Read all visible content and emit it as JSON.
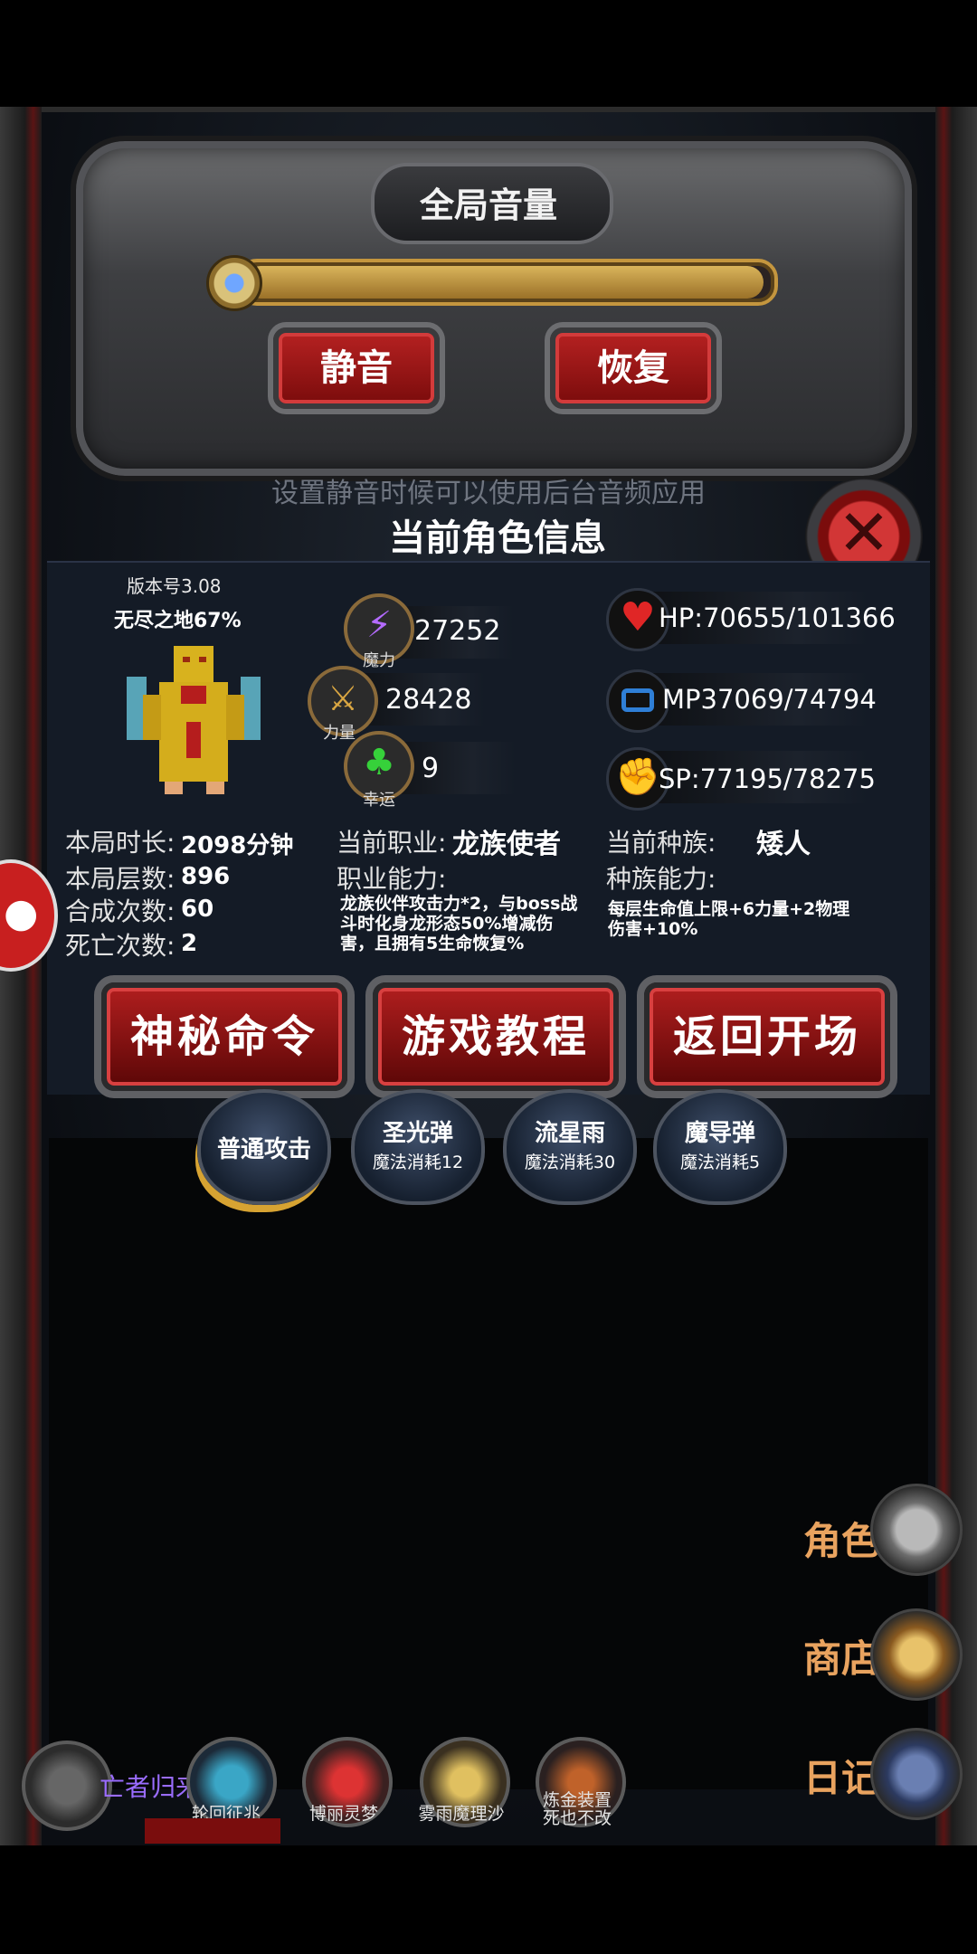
{
  "volume": {
    "title": "全局音量",
    "level_fraction": 1.0,
    "mute_label": "静音",
    "restore_label": "恢复",
    "hint": "设置静音时候可以使用后台音频应用"
  },
  "info": {
    "title": "当前角色信息",
    "version": "版本号3.08",
    "floor_pct": "无尽之地67%",
    "magic": {
      "value": "27252",
      "label": "魔力"
    },
    "strength": {
      "value": "28428",
      "label": "力量"
    },
    "luck": {
      "value": "9",
      "label": "幸运"
    },
    "hp": "HP:70655/101366",
    "mp": "MP37069/74794",
    "sp": "SP:77195/78275",
    "duration_label": "本局时长:",
    "duration_value": "2098分钟",
    "floors_label": "本局层数:",
    "floors_value": "896",
    "synth_label": "合成次数:",
    "synth_value": "60",
    "death_label": "死亡次数:",
    "death_value": "2",
    "job_label": "当前职业:",
    "job_value": "龙族使者",
    "job_ability_label": "职业能力:",
    "job_ability_desc": "龙族伙伴攻击力*2，与boss战斗时化身龙形态50%增减伤害，且拥有5生命恢复%",
    "race_label": "当前种族:",
    "race_value": "矮人",
    "race_ability_label": "种族能力:",
    "race_ability_desc": "每层生命值上限+6力量+2物理伤害+10%"
  },
  "actions": {
    "mystery_cmd": "神秘命令",
    "tutorial": "游戏教程",
    "back_to_start": "返回开场"
  },
  "skills": [
    {
      "name": "普通攻击",
      "cost": ""
    },
    {
      "name": "圣光弹",
      "cost": "魔法消耗12"
    },
    {
      "name": "流星雨",
      "cost": "魔法消耗30"
    },
    {
      "name": "魔导弹",
      "cost": "魔法消耗5"
    }
  ],
  "side_menu": {
    "character": "角色",
    "shop": "商店",
    "diary": "日记"
  },
  "bottom": {
    "undead_return": "亡者归来",
    "items": [
      "轮回征兆",
      "博丽灵梦",
      "雾雨魔理沙",
      "炼金装置\n死也不改"
    ]
  },
  "colors": {
    "accent_red": "#b01e1e",
    "gold": "#c4963e",
    "side_label": "#e9a35f"
  }
}
